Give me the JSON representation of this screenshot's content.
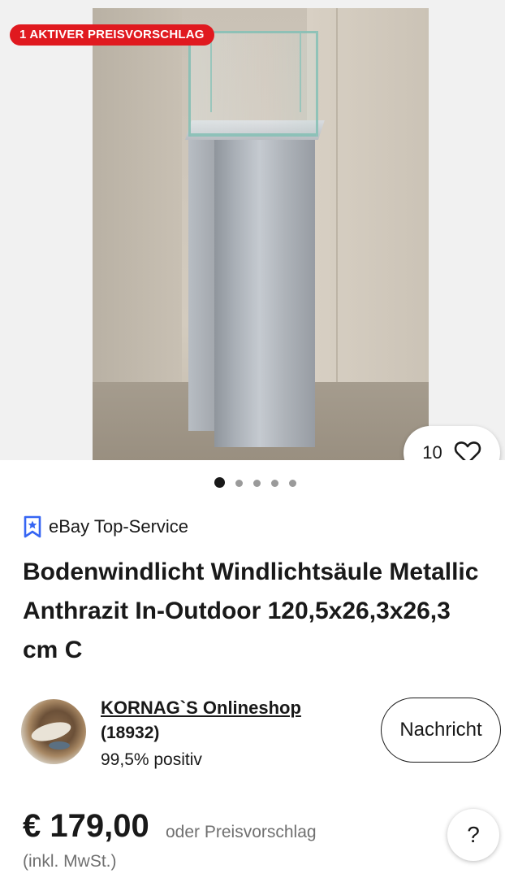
{
  "gallery": {
    "offer_badge": "1 AKTIVER PREISVORSCHLAG",
    "watch_count": "10",
    "dots_total": 5,
    "dots_active_index": 0
  },
  "listing": {
    "top_service": "eBay Top-Service",
    "title": "Bodenwindlicht Windlichtsäule Metallic Anthrazit In-Outdoor 120,5x26,3x26,3 cm C"
  },
  "seller": {
    "name": "KORNAG`S Onlineshop",
    "feedback_count": "(18932)",
    "rating": "99,5% positiv",
    "message_button": "Nachricht"
  },
  "price": {
    "amount": "€ 179,00",
    "note": "oder Preisvorschlag",
    "tax": "(inkl. MwSt.)"
  },
  "help": {
    "label": "?"
  },
  "colors": {
    "badge_red": "#e0191f",
    "text": "#191919",
    "muted": "#707070",
    "top_service_blue": "#3665f3"
  }
}
